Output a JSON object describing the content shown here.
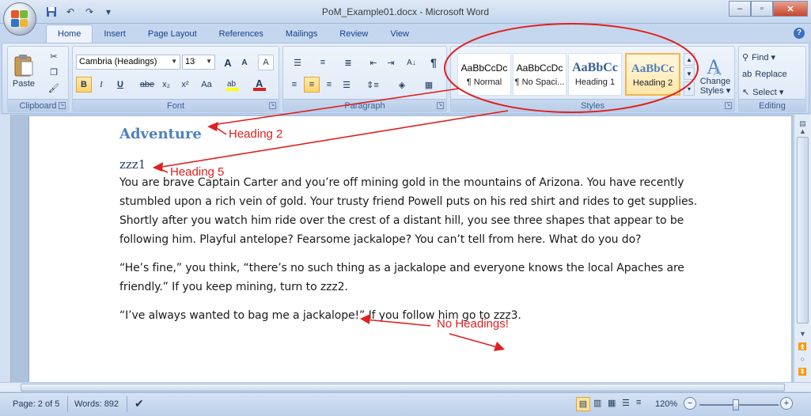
{
  "window": {
    "title": "PoM_Example01.docx - Microsoft Word",
    "minimize": "–",
    "maximize": "▫",
    "close": "✕"
  },
  "tabs": [
    "Home",
    "Insert",
    "Page Layout",
    "References",
    "Mailings",
    "Review",
    "View"
  ],
  "help": "?",
  "clipboard": {
    "paste": "Paste",
    "group_label": "Clipboard"
  },
  "font": {
    "family": "Cambria (Headings)",
    "size": "13",
    "group_label": "Font",
    "bold": "B",
    "italic": "I",
    "underline": "U",
    "strike": "abe",
    "subscript": "x₂",
    "superscript": "x²",
    "change_case": "Aa",
    "grow": "A",
    "shrink": "A",
    "clear": "A"
  },
  "paragraph": {
    "group_label": "Paragraph",
    "show_marks": "¶",
    "sort": "A↓"
  },
  "styles": {
    "group_label": "Styles",
    "tiles": [
      {
        "preview": "AaBbCcDc",
        "name": "¶ Normal",
        "selected": false
      },
      {
        "preview": "AaBbCcDc",
        "name": "¶ No Spaci...",
        "selected": false
      },
      {
        "preview": "AaBbCc",
        "name": "Heading 1",
        "selected": false
      },
      {
        "preview": "AaBbCc",
        "name": "Heading 2",
        "selected": true
      }
    ],
    "change_styles": "Change Styles",
    "change_styles_l1": "Change",
    "change_styles_l2": "Styles ▾"
  },
  "editing": {
    "group_label": "Editing",
    "find": "Find ▾",
    "replace": "Replace",
    "select": "Select ▾"
  },
  "document": {
    "heading2": "Adventure",
    "heading5": "zzz1",
    "paragraphs": [
      "You are brave Captain Carter and you’re off mining gold in the mountains of Arizona.  You have recently stumbled upon a rich vein of gold.  Your trusty friend Powell puts on his red shirt and rides to get supplies.  Shortly after you watch him ride over the crest of a distant hill, you see three shapes that appear to be following him.  Playful antelope?  Fearsome jackalope?  You can’t tell from here.  What do you do?",
      "“He’s fine,” you think, “there’s no such thing as a jackalope and everyone knows the local Apaches are friendly.”  If you keep mining, turn to zzz2.",
      "“I’ve always wanted to bag me a jackalope!”  If you follow him go to zzz3."
    ]
  },
  "annotations": {
    "heading2_label": "Heading 2",
    "heading5_label": "Heading 5",
    "no_headings_label": "No Headings!"
  },
  "status": {
    "page": "Page: 2 of 5",
    "words": "Words: 892",
    "zoom": "120%"
  },
  "colors": {
    "heading2": "#4f81bd",
    "annotation_red": "#e0201f",
    "selected_style_border": "#f4b64c"
  }
}
